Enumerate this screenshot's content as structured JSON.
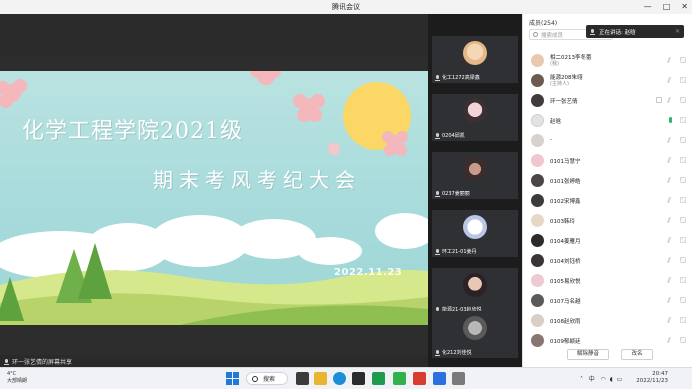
{
  "window": {
    "title": "腾讯会议",
    "controls": [
      "—",
      "□",
      "✕"
    ]
  },
  "slide": {
    "title": "化学工程学院2021级",
    "subtitle": "期末考风考纪大会",
    "date": "2022.11.23"
  },
  "share_bar": {
    "label": "环一张艺倩的屏幕共享"
  },
  "video_tiles": [
    {
      "name": "化工1272高梁鑫"
    },
    {
      "name": "0204邱凯"
    },
    {
      "name": "0237姜丽丽"
    },
    {
      "name": "环工21-01姜丹"
    },
    {
      "name": "能源21-03赵欣悦"
    },
    {
      "name": "化212刘佳悦"
    }
  ],
  "panel": {
    "header": "成员(254)",
    "search_placeholder": "搜索成员",
    "speaking_label": "正在讲话: 赵晗",
    "participants": [
      {
        "name": "相二0213李冬蕾",
        "role": "(我)"
      },
      {
        "name": "能源208朱翊",
        "role": "(主持人)"
      },
      {
        "name": "环一张艺倩",
        "role": ""
      },
      {
        "name": "赵晗",
        "role": ""
      },
      {
        "name": "-",
        "role": ""
      },
      {
        "name": "0101马慧宁",
        "role": ""
      },
      {
        "name": "0101张婷皓",
        "role": ""
      },
      {
        "name": "0102宋博鑫",
        "role": ""
      },
      {
        "name": "0103韩玲",
        "role": ""
      },
      {
        "name": "0104姜雁月",
        "role": ""
      },
      {
        "name": "0104刘钰桥",
        "role": ""
      },
      {
        "name": "0105易欣悦",
        "role": ""
      },
      {
        "name": "0107马名越",
        "role": ""
      },
      {
        "name": "0108赵欣雨",
        "role": ""
      },
      {
        "name": "0109郁颖廷",
        "role": ""
      }
    ],
    "btn_unmute_all": "解除静音",
    "btn_rename": "改名"
  },
  "taskbar": {
    "weather_temp": "4°C",
    "weather_desc": "大部晴朗",
    "search_label": "搜索",
    "ime": "中",
    "time": "20:47",
    "date": "2022/11/23"
  },
  "colors": {
    "slide_bg": "#a6dadb",
    "mic_active": "#2ab56f",
    "accent": "#1f7bd6"
  }
}
